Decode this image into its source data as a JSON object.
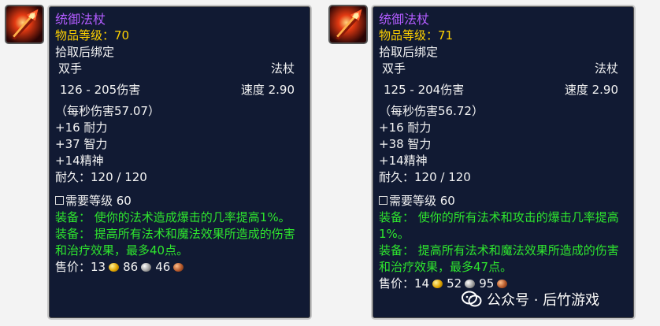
{
  "items": [
    {
      "name": "统御法杖",
      "item_level": "物品等级：70",
      "bind": "拾取后绑定",
      "slot": "双手",
      "type": "法杖",
      "damage": "126 - 205伤害",
      "speed": "速度 2.90",
      "dps": "（每秒伤害57.07）",
      "stats": [
        "+16 耐力",
        "+37 智力",
        "+14精神"
      ],
      "durability": "耐久：120 / 120",
      "requirement": "需要等级 60",
      "equip1": "装备：  使你的法术造成爆击的几率提高1%。",
      "equip2": "装备：  提高所有法术和魔法效果所造成的伤害和治疗效果，最多40点。",
      "sell_label": "售价：",
      "gold": "13",
      "silver": "86",
      "copper": "46"
    },
    {
      "name": "统御法杖",
      "item_level": "物品等级：71",
      "bind": "拾取后绑定",
      "slot": "双手",
      "type": "法杖",
      "damage": "125 - 204伤害",
      "speed": "速度 2.90",
      "dps": "（每秒伤害56.72）",
      "stats": [
        "+16 耐力",
        "+38 智力",
        "+14精神"
      ],
      "durability": "耐久：120 / 120",
      "requirement": "需要等级 60",
      "equip1": "装备：  使你的所有法术和攻击的爆击几率提高1%。",
      "equip2": "装备：  提高所有法术和魔法效果所造成的伤害和治疗效果，最多47点。",
      "sell_label": "售价：",
      "gold": "14",
      "silver": "52",
      "copper": "95"
    }
  ],
  "watermark": "公众号 · 后竹游戏",
  "colors": {
    "tooltip_bg": "#111a33",
    "title": "#b35cff",
    "item_level": "#ffd200",
    "equip_text": "#2ee62e"
  }
}
